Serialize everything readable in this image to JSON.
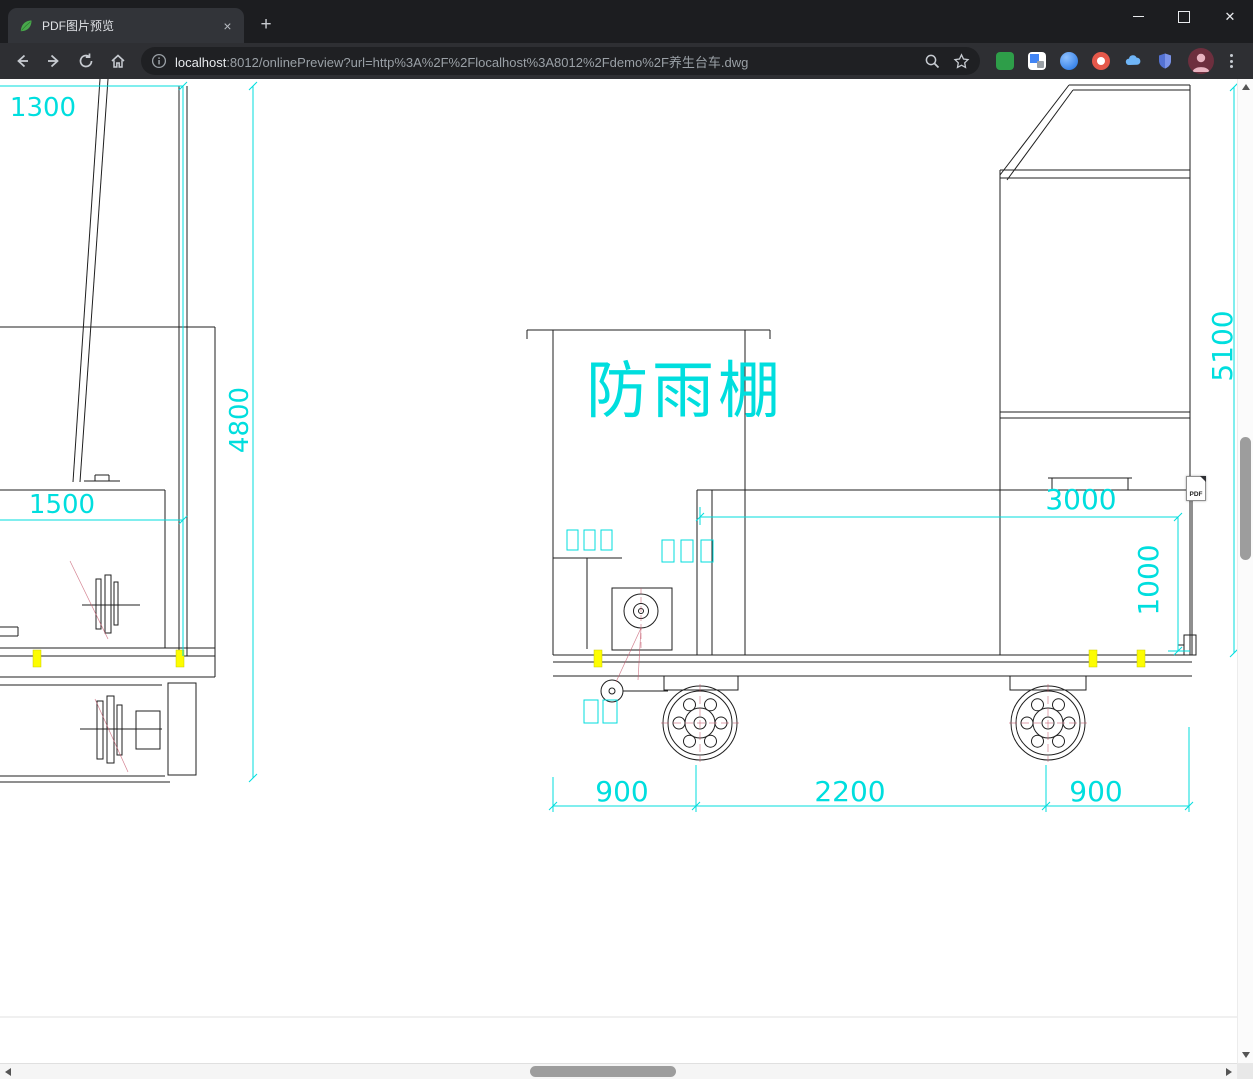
{
  "window": {
    "controls": {
      "close_glyph": "✕"
    }
  },
  "browser": {
    "tab": {
      "title": "PDF图片预览",
      "close_glyph": "×"
    },
    "new_tab_glyph": "+",
    "url": {
      "host": "localhost",
      "rest": ":8012/onlinePreview?url=http%3A%2F%2Flocalhost%3A8012%2Fdemo%2F养生台车.dwg"
    }
  },
  "drawing": {
    "shelter_label": "防雨棚",
    "dims": {
      "mast_width": "1300",
      "left_height": "4800",
      "tank_width": "1500",
      "total_height": "5100",
      "deck_length": "3000",
      "deck_height": "1000",
      "axle_left": "900",
      "axle_span": "2200",
      "axle_right": "900"
    },
    "colors": {
      "dimension": "#00dede",
      "outline": "#1f1f1f",
      "highlight": "#fdfd00",
      "centerline": "#c65a6e"
    }
  },
  "overlay": {
    "pdf_badge": "PDF"
  }
}
